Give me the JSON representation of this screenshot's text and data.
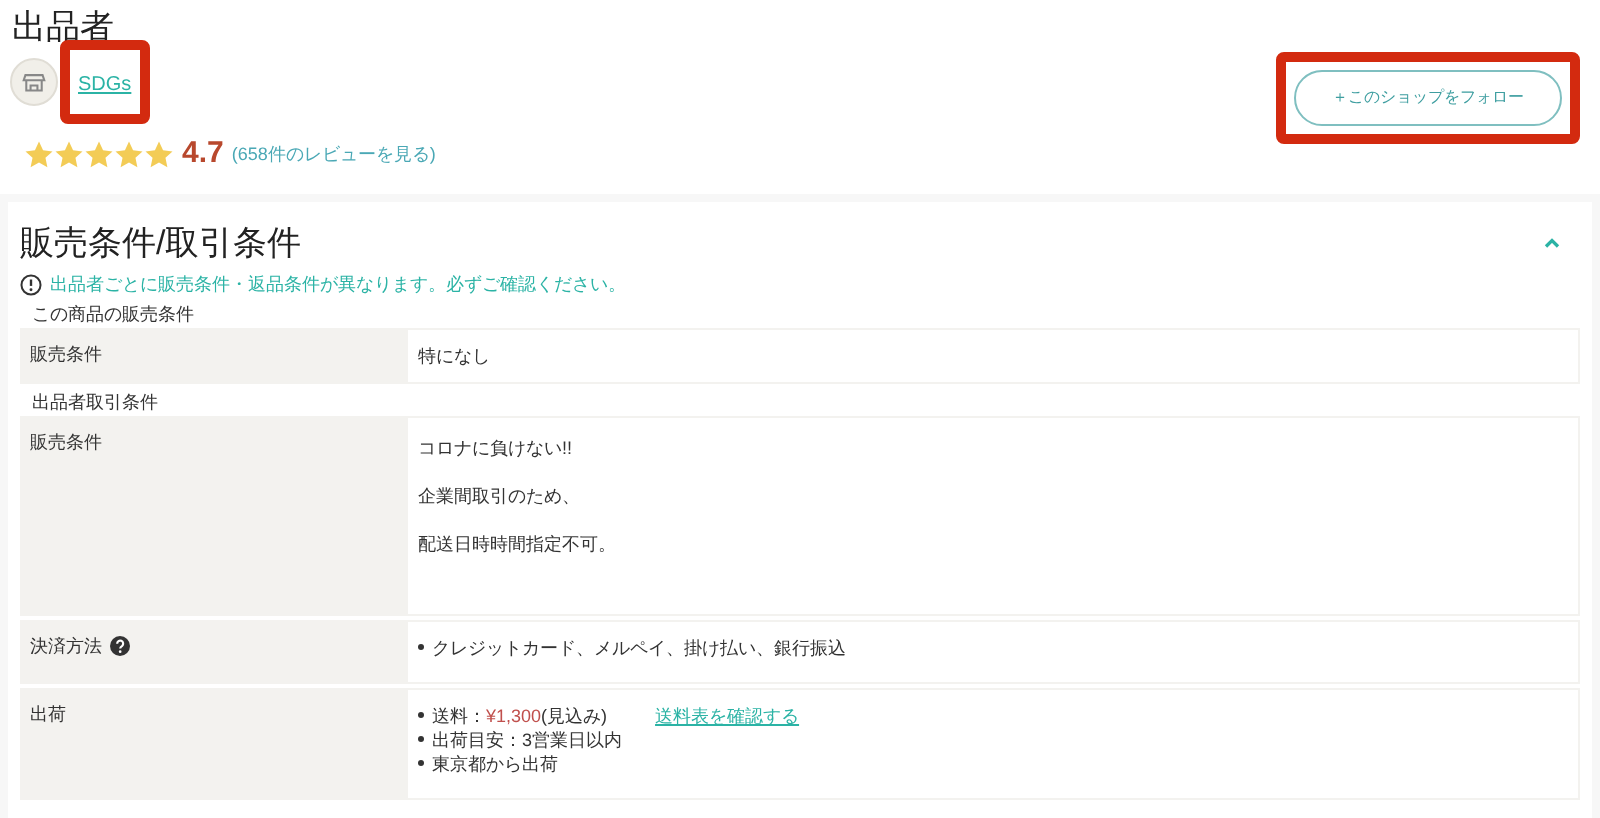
{
  "seller": {
    "heading": "出品者",
    "shop_name": "SDGs",
    "shop_highlighted": true,
    "follow_button": "＋このショップをフォロー",
    "follow_highlighted": true,
    "stars": 5,
    "rating": "4.7",
    "reviews_link": "(658件のレビューを見る)"
  },
  "conditions": {
    "heading": "販売条件/取引条件",
    "expanded": true,
    "notice": "出品者ごとに販売条件・返品条件が異なります。必ずご確認ください。",
    "groups": [
      {
        "title": "この商品の販売条件",
        "rows": [
          {
            "label": "販売条件",
            "help": false,
            "kind": "paragraphs",
            "lines": [
              "特になし"
            ]
          }
        ]
      },
      {
        "title": "出品者取引条件",
        "rows": [
          {
            "label": "販売条件",
            "help": false,
            "kind": "paragraphs",
            "lines": [
              "コロナに負けない!!",
              "企業間取引のため、",
              "配送日時時間指定不可。"
            ]
          },
          {
            "label": "決済方法",
            "help": true,
            "kind": "bullets",
            "items": [
              {
                "kind": "text",
                "text": "クレジットカード、メルペイ、掛け払い、銀行振込"
              }
            ]
          },
          {
            "label": "出荷",
            "help": false,
            "kind": "bullets",
            "items": [
              {
                "kind": "price",
                "label": "送料：",
                "price": "¥1,300",
                "suffix": "(見込み)",
                "link": "送料表を確認する"
              },
              {
                "kind": "text",
                "text": "出荷目安：3営業日以内"
              },
              {
                "kind": "text",
                "text": "東京都から出荷"
              }
            ]
          }
        ]
      }
    ]
  }
}
